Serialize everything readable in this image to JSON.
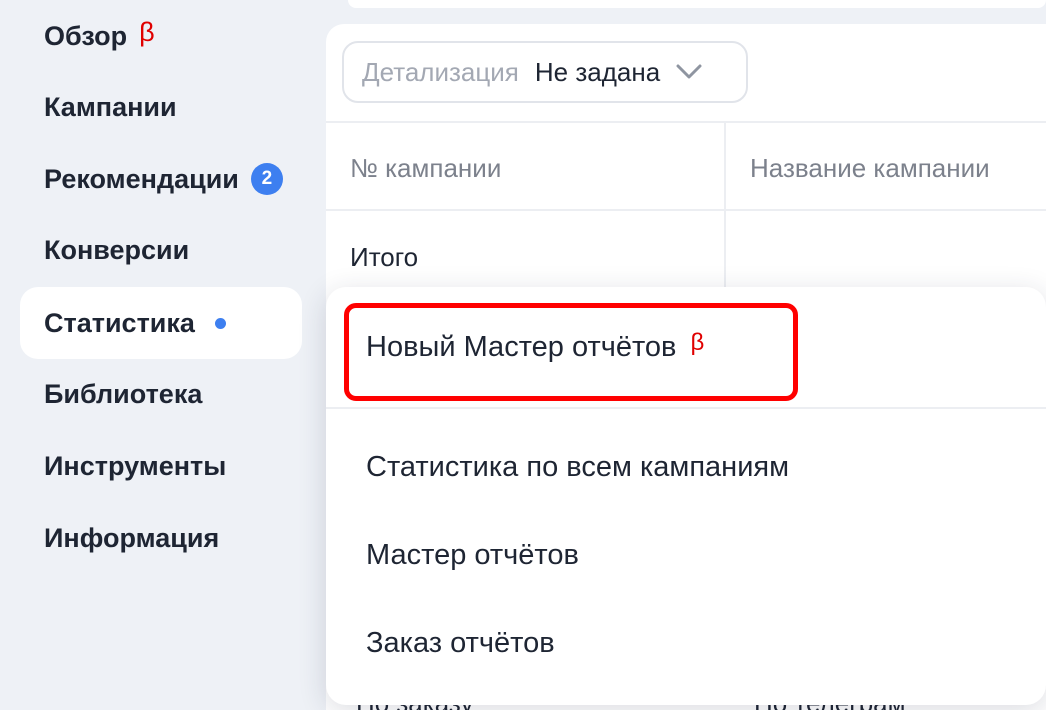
{
  "sidebar": {
    "items": [
      {
        "label": "Обзор",
        "beta": "β"
      },
      {
        "label": "Кампании"
      },
      {
        "label": "Рекомендации",
        "badge": "2"
      },
      {
        "label": "Конверсии"
      },
      {
        "label": "Статистика",
        "active": true
      },
      {
        "label": "Библиотека"
      },
      {
        "label": "Инструменты"
      },
      {
        "label": "Информация"
      }
    ]
  },
  "filter": {
    "label": "Детализация",
    "value": "Не задана"
  },
  "table": {
    "columns": [
      "№ кампании",
      "Название кампании"
    ],
    "total_label": "Итого",
    "partial_row": [
      "По заказу",
      "По телеграм"
    ]
  },
  "dropdown": {
    "items": [
      {
        "label": "Новый Мастер отчётов",
        "beta": "β",
        "highlighted": true
      },
      {
        "label": "Статистика по всем кампаниям"
      },
      {
        "label": "Мастер отчётов"
      },
      {
        "label": "Заказ отчётов"
      }
    ]
  },
  "colors": {
    "accent": "#3d7ff0",
    "beta": "#e00000",
    "highlight_border": "#ff0000",
    "sidebar_bg": "#eef1f6"
  },
  "icons": {
    "filter_chevron": "chevron-down-icon",
    "status_dot": "active-dot"
  }
}
